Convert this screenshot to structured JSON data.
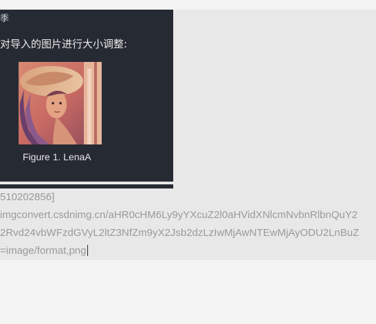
{
  "panel": {
    "partial_heading": "季",
    "instruction": "对导入的图片进行大小调整:",
    "figure_caption": "Figure 1. LenaA"
  },
  "source": {
    "line1": "510202856]",
    "line2": "imgconvert.csdnimg.cn/aHR0cHM6Ly9yYXcuZ2l0aHVidXNlcmNvbnRlbnQuY2",
    "line3": "2Rvd24vbWFzdGVyL2ltZ3NfZm9yX2Jsb2dzLzIwMjAwNTEwMjAyODU2LnBuZ",
    "line4": "=image/format,png"
  },
  "colors": {
    "panel_bg": "#262a33",
    "editor_bg": "#e8e8e8",
    "source_text": "#9a9a9a"
  }
}
